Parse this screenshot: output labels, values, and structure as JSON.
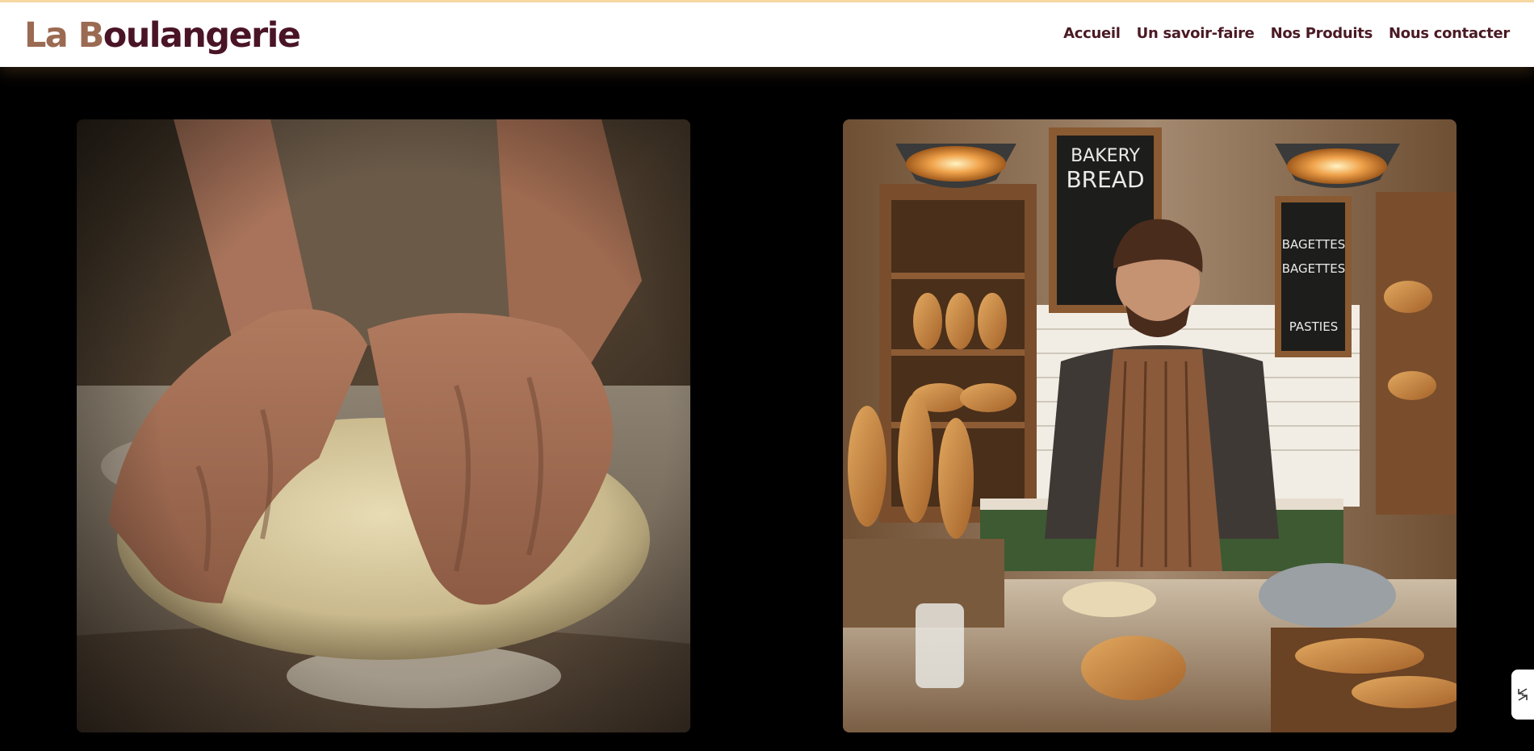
{
  "header": {
    "logo_part1": "La B",
    "logo_part2": "oulangerie",
    "logo_color_1": "#9b6a52",
    "logo_color_2": "#4a1427"
  },
  "nav": {
    "items": [
      {
        "label": "Accueil"
      },
      {
        "label": "Un savoir-faire"
      },
      {
        "label": "Nos Produits"
      },
      {
        "label": "Nous contacter"
      }
    ]
  },
  "images": {
    "left_icon": "kneading-dough-photo",
    "right_icon": "baker-in-bakery-photo",
    "chalkboard_1_line1": "BAKERY",
    "chalkboard_1_line2": "BREAD",
    "chalkboard_2_line1": "BAGETTES",
    "chalkboard_2_line2": "BAGETTES",
    "chalkboard_2_line3": "PASTIES"
  },
  "widget": {
    "icon": "collapse-arrows-icon"
  },
  "colors": {
    "background": "#000000",
    "nav_text": "#4a1a24",
    "accent": "#f6d9a6"
  }
}
